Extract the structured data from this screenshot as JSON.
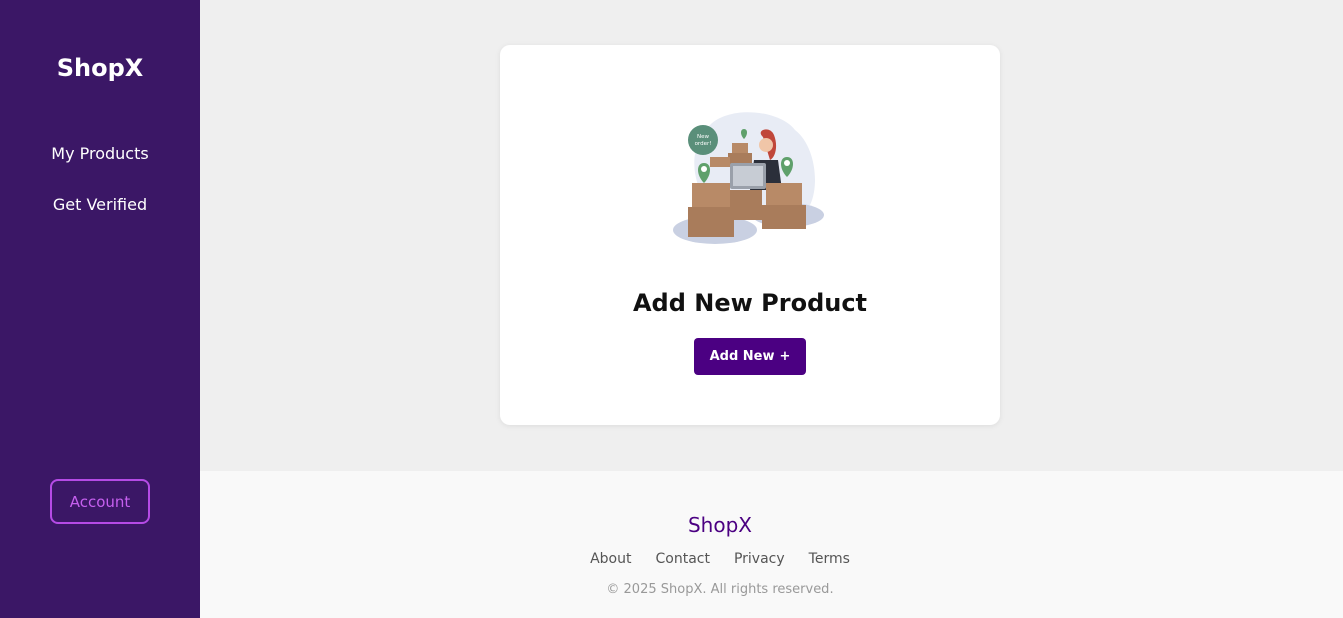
{
  "sidebar": {
    "brand": "ShopX",
    "items": [
      {
        "label": "My Products"
      },
      {
        "label": "Get Verified"
      }
    ],
    "account_label": "Account"
  },
  "card": {
    "illustration": {
      "icon": "new-order-illustration",
      "bubble_text_1": "New",
      "bubble_text_2": "order!"
    },
    "title": "Add New Product",
    "button_label": "Add New",
    "button_icon": "+"
  },
  "footer": {
    "brand": "ShopX",
    "links": [
      "About",
      "Contact",
      "Privacy",
      "Terms"
    ],
    "copyright": "© 2025 ShopX. All rights reserved."
  },
  "colors": {
    "sidebar_bg": "#3b1766",
    "accent": "#4b0082",
    "account_border": "#b54be6"
  }
}
